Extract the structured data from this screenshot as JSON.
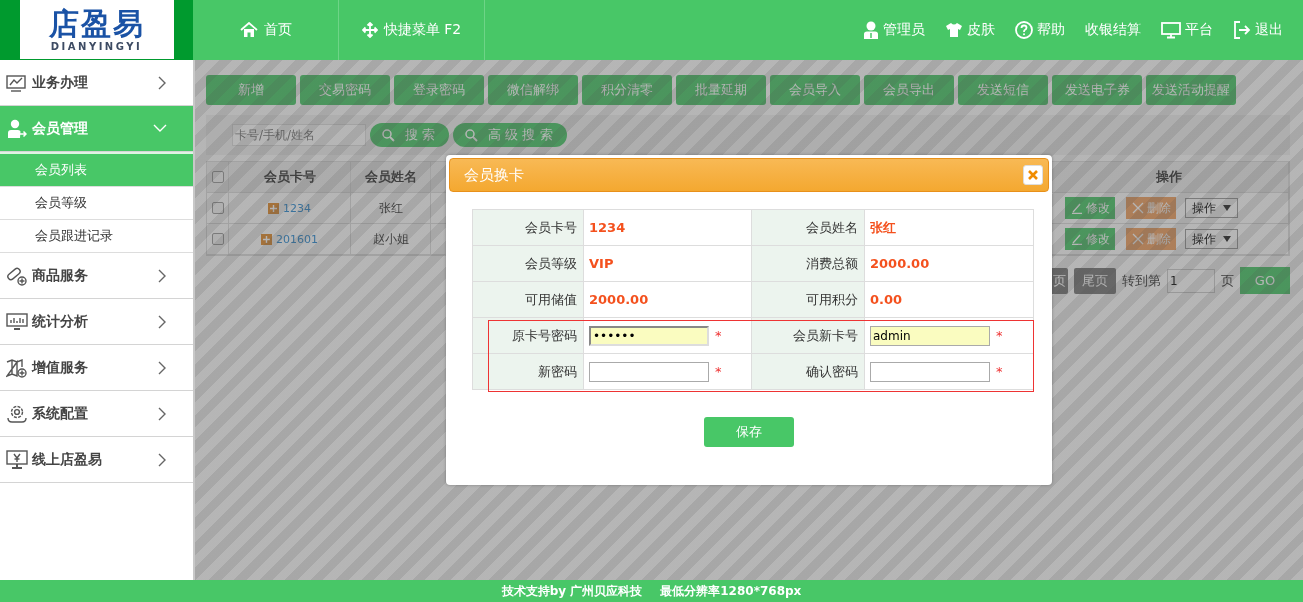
{
  "logo": {
    "title": "店盈易",
    "subtitle": "DIANYINGYI"
  },
  "top_nav": [
    {
      "label": "首页"
    },
    {
      "label": "快捷菜单 F2"
    }
  ],
  "user_menu": [
    {
      "label": "管理员"
    },
    {
      "label": "皮肤"
    },
    {
      "label": "帮助"
    },
    {
      "label": "收银结算"
    },
    {
      "label": "平台"
    },
    {
      "label": "退出"
    }
  ],
  "sidebar": {
    "items": [
      {
        "label": "业务办理",
        "expanded": false,
        "selected": false
      },
      {
        "label": "会员管理",
        "expanded": true,
        "selected": true,
        "children": [
          {
            "label": "会员列表",
            "selected": true
          },
          {
            "label": "会员等级",
            "selected": false
          },
          {
            "label": "会员跟进记录",
            "selected": false
          }
        ]
      },
      {
        "label": "商品服务",
        "expanded": false,
        "selected": false
      },
      {
        "label": "统计分析",
        "expanded": false,
        "selected": false
      },
      {
        "label": "增值服务",
        "expanded": false,
        "selected": false
      },
      {
        "label": "系统配置",
        "expanded": false,
        "selected": false
      },
      {
        "label": "线上店盈易",
        "expanded": false,
        "selected": false
      }
    ]
  },
  "toolbar": {
    "buttons": [
      "新增",
      "交易密码",
      "登录密码",
      "微信解绑",
      "积分清零",
      "批量延期",
      "会员导入",
      "会员导出",
      "发送短信",
      "发送电子券",
      "发送活动提醒"
    ]
  },
  "search": {
    "placeholder": "卡号/手机/姓名",
    "buttons": [
      "搜 索",
      "高 级 搜 索"
    ]
  },
  "table": {
    "header_checked": false,
    "columns": [
      "会员卡号",
      "会员姓名",
      "操作"
    ],
    "rows": [
      {
        "checked": false,
        "card_no": "1234",
        "name": "张红",
        "actions": [
          "修改",
          "删除"
        ],
        "menu": "操作"
      },
      {
        "checked": false,
        "card_no": "201601",
        "name": "赵小姐",
        "actions": [
          "修改",
          "删除"
        ],
        "menu": "操作"
      }
    ]
  },
  "pagination": {
    "buttons": [
      "页",
      "尾页"
    ],
    "goto_label": "转到第",
    "page": "1",
    "page_suffix": "页",
    "go": "GO"
  },
  "dialog": {
    "title": "会员换卡",
    "info": [
      {
        "label": "会员卡号",
        "value": "1234"
      },
      {
        "label": "会员姓名",
        "value": "张红"
      },
      {
        "label": "会员等级",
        "value": "VIP"
      },
      {
        "label": "消费总额",
        "value": "2000.00"
      },
      {
        "label": "可用储值",
        "value": "2000.00"
      },
      {
        "label": "可用积分",
        "value": "0.00"
      }
    ],
    "inputs_outlined": true,
    "inputs": [
      {
        "label": "原卡号密码",
        "value": "••••••",
        "highlighted": true,
        "focused": true,
        "required_mark": "*"
      },
      {
        "label": "会员新卡号",
        "value": "admin",
        "highlighted": true,
        "focused": false,
        "required_mark": "*"
      },
      {
        "label": "新密码",
        "highlighted": false,
        "focused": false,
        "required_mark": "*"
      },
      {
        "label": "确认密码",
        "highlighted": false,
        "focused": false,
        "required_mark": "*"
      }
    ],
    "save": "保存"
  },
  "footer": [
    "技术支持by 广州贝应科技",
    "最低分辨率1280*768px"
  ]
}
